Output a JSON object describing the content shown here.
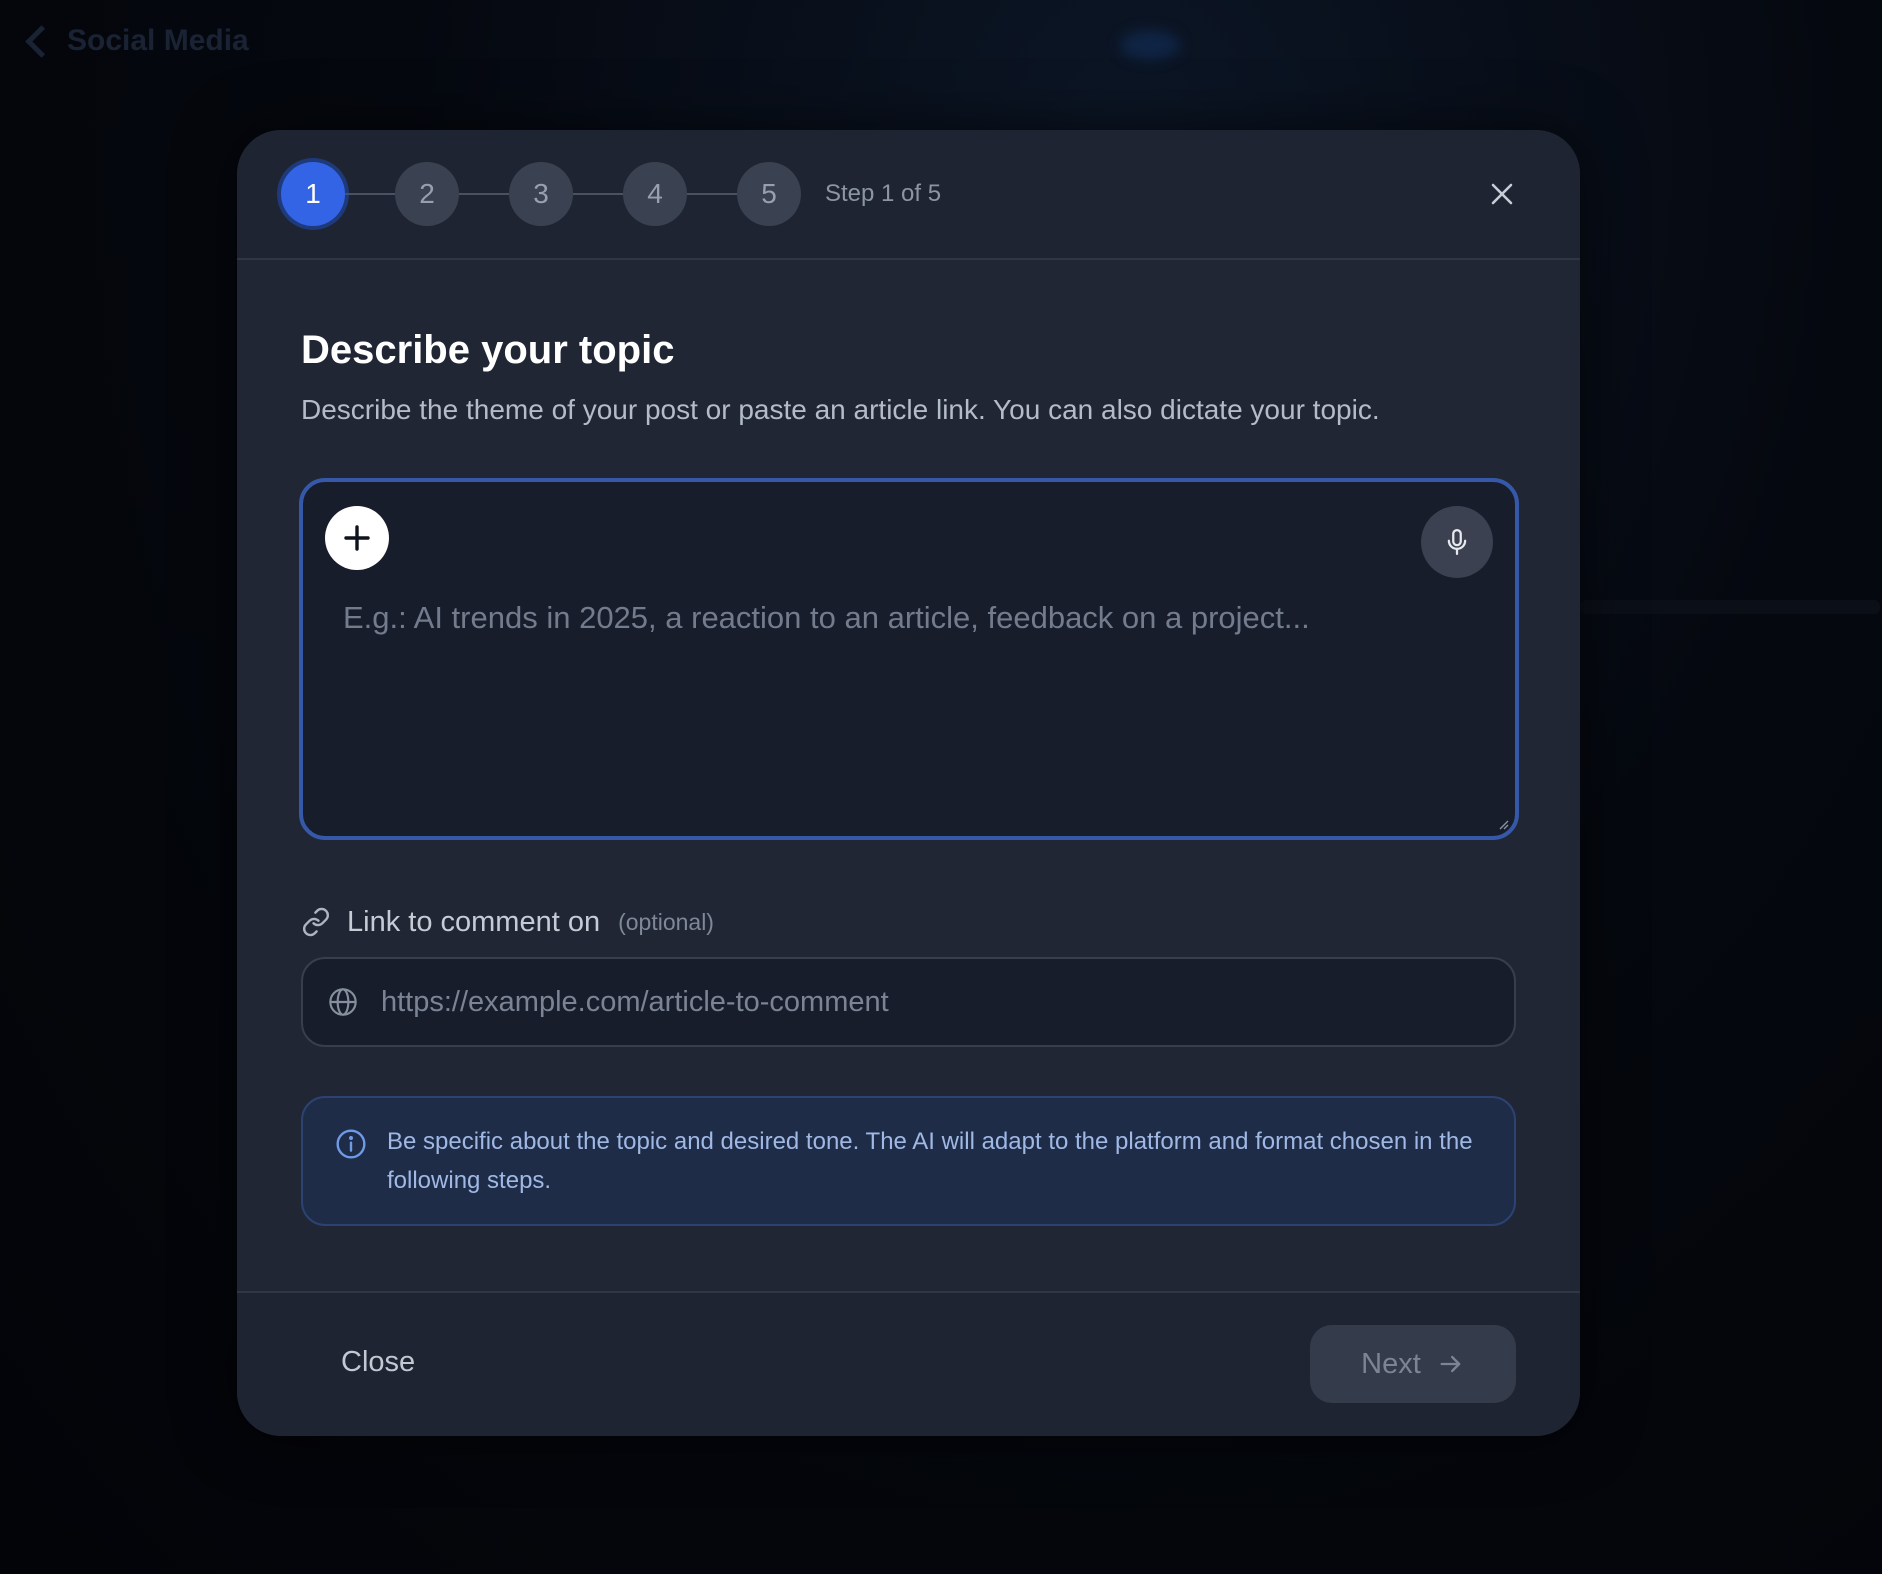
{
  "background": {
    "back_label": "Social Media"
  },
  "stepper": {
    "steps": [
      "1",
      "2",
      "3",
      "4",
      "5"
    ],
    "active_step": 1,
    "status_text": "Step 1 of 5"
  },
  "header": {
    "title": "Describe your topic",
    "subtitle": "Describe the theme of your post or paste an article link. You can also dictate your topic."
  },
  "topic": {
    "value": "",
    "placeholder": "E.g.: AI trends in 2025, a reaction to an article, feedback on a project..."
  },
  "link": {
    "label": "Link to comment on",
    "optional": "(optional)",
    "value": "",
    "placeholder": "https://example.com/article-to-comment"
  },
  "info": {
    "text": "Be specific about the topic and desired tone. The AI will adapt to the platform and format chosen in the following steps."
  },
  "footer": {
    "close_label": "Close",
    "next_label": "Next"
  },
  "colors": {
    "accent": "#3464e6",
    "modal_bg": "#202634",
    "focus_border": "#3559a8",
    "info_bg": "#1e2c48",
    "info_text": "#9fb8e4"
  },
  "icons": {
    "add": "plus-icon",
    "dictate": "microphone-icon",
    "close": "close-icon",
    "link": "link-icon",
    "url": "globe-icon",
    "info": "info-icon",
    "next": "arrow-right-icon"
  }
}
